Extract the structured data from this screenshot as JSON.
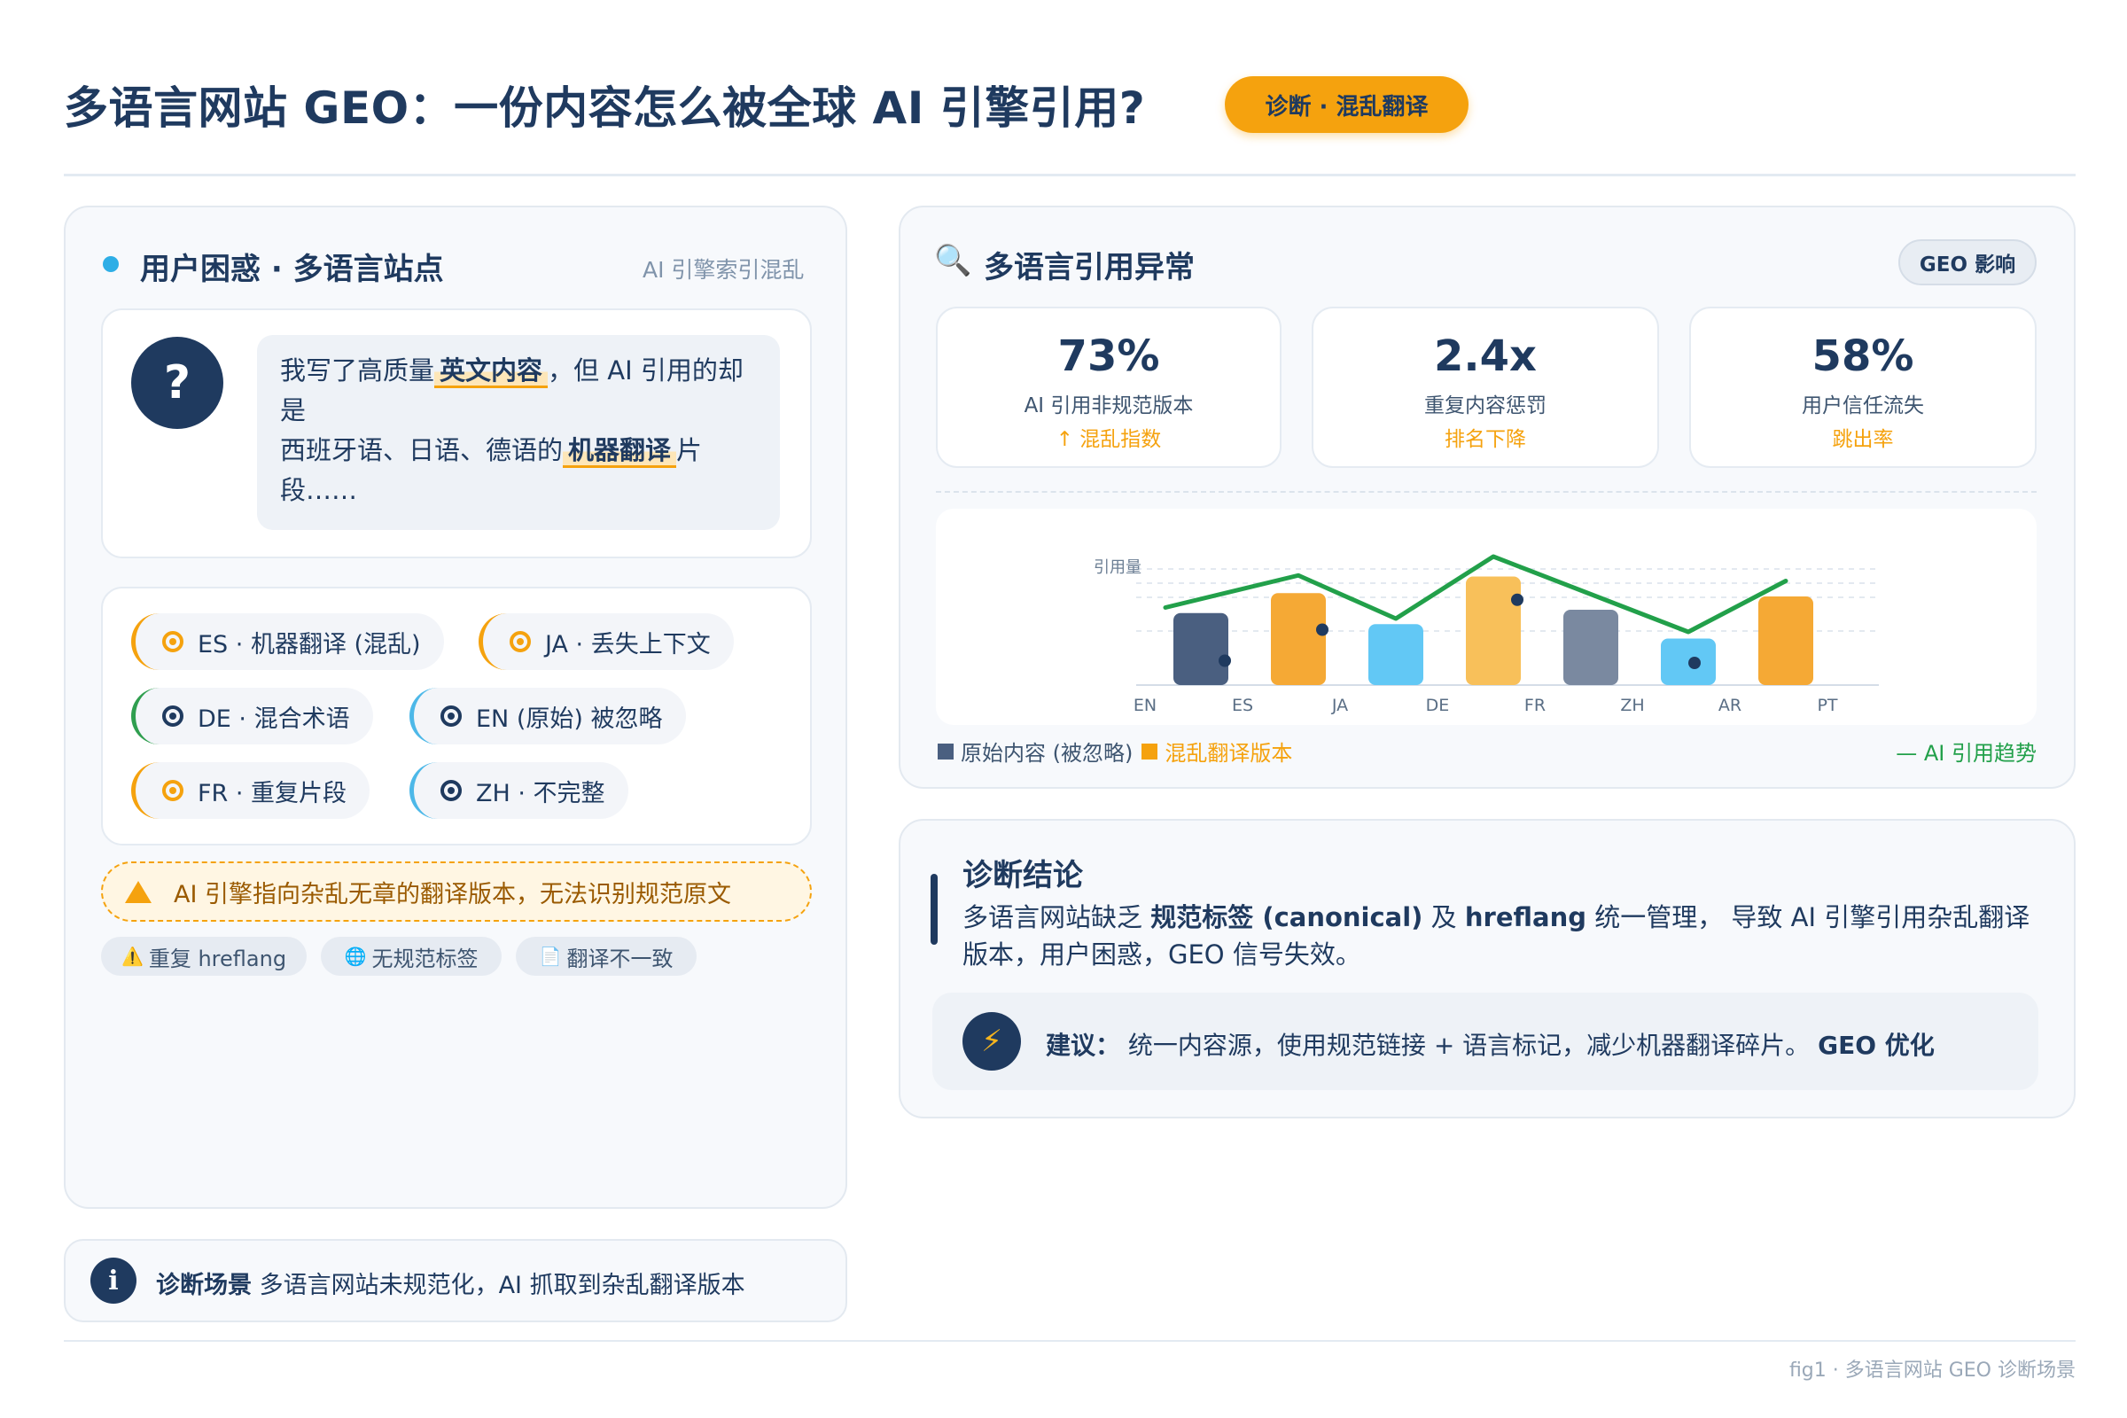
{
  "header": {
    "title": "多语言网站 GEO：一份内容怎么被全球 AI 引擎引用?",
    "badge": "诊断 · 混乱翻译"
  },
  "left_panel": {
    "title": "用户困惑 · 多语言站点",
    "subtitle": "AI 引擎索引混乱",
    "question_icon": "?",
    "quote": {
      "part1": "我写了高质量",
      "hl1": "英文内容",
      "part2": "，但 AI 引用的却是",
      "part3": "西班牙语、日语、德语的",
      "hl2": "机器翻译",
      "part4": "片段……"
    },
    "tags": [
      {
        "label": "ES · 机器翻译 (混乱)",
        "accent": "#f5a20e"
      },
      {
        "label": "JA · 丢失上下文",
        "accent": "#f5a20e"
      },
      {
        "label": "DE · 混合术语",
        "accent": "#2f9e4f"
      },
      {
        "label": "EN (原始) 被忽略",
        "accent": "#4db8e8"
      },
      {
        "label": "FR · 重复片段",
        "accent": "#f5a20e"
      },
      {
        "label": "ZH · 不完整",
        "accent": "#4db8e8"
      }
    ],
    "warning": "AI 引擎指向杂乱无章的翻译版本，无法识别规范原文",
    "pills": [
      {
        "icon": "⚠️",
        "label": "重复 hreflang"
      },
      {
        "icon": "🌐",
        "label": "无规范标签"
      },
      {
        "icon": "📄",
        "label": "翻译不一致"
      }
    ]
  },
  "scenario": {
    "icon": "i",
    "bold": "诊断场景",
    "text": " 多语言网站未规范化，AI 抓取到杂乱翻译版本"
  },
  "right_panel": {
    "title": "多语言引用异常",
    "search_icon": "🔍",
    "badge": "GEO 影响",
    "metrics": [
      {
        "value": "73%",
        "label": "AI 引用非规范版本",
        "sub": "↑ 混乱指数"
      },
      {
        "value": "2.4x",
        "label": "重复内容惩罚",
        "sub": "排名下降"
      },
      {
        "value": "58%",
        "label": "用户信任流失",
        "sub": "跳出率"
      }
    ],
    "legend": {
      "original": "原始内容 (被忽略)",
      "messy": "混乱翻译版本",
      "trend": "— AI 引用趋势"
    }
  },
  "chart_data": {
    "type": "bar",
    "ylabel": "引用量",
    "categories": [
      "EN",
      "ES",
      "JA",
      "DE",
      "FR",
      "ZH",
      "AR",
      "PT"
    ],
    "bars": [
      {
        "value": 65,
        "color": "#4a5f80"
      },
      {
        "value": 83,
        "color": "#f5a935"
      },
      {
        "value": 55,
        "color": "#62c8f5"
      },
      {
        "value": 98,
        "color": "#f8c05a"
      },
      {
        "value": 68,
        "color": "#7a89a0"
      },
      {
        "value": 42,
        "color": "#62c8f5"
      },
      {
        "value": 80,
        "color": "#f5a935"
      }
    ],
    "trend_line": [
      70,
      99,
      60,
      116,
      82,
      48,
      94
    ],
    "dots": [
      30,
      58,
      85,
      28
    ],
    "colors": {
      "trend": "#22a04a",
      "dot": "#1f3a5f",
      "grid": "#e3e9f0"
    }
  },
  "conclusion": {
    "title": "诊断结论",
    "p1": "多语言网站缺乏 ",
    "b1": "规范标签 (canonical)",
    "p2": " 及 ",
    "b2": "hreflang",
    "p3": " 统一管理， 导致 AI 引擎引用杂乱翻译版本，用户困惑，GEO 信号失效。",
    "advice_icon": "⚡",
    "advice_bold": "建议：",
    "advice_text": " 统一内容源，使用规范链接 + 语言标记，减少机器翻译碎片。 ",
    "advice_tail": "GEO 优化"
  },
  "footer": {
    "caption": "fig1 · 多语言网站 GEO 诊断场景"
  }
}
